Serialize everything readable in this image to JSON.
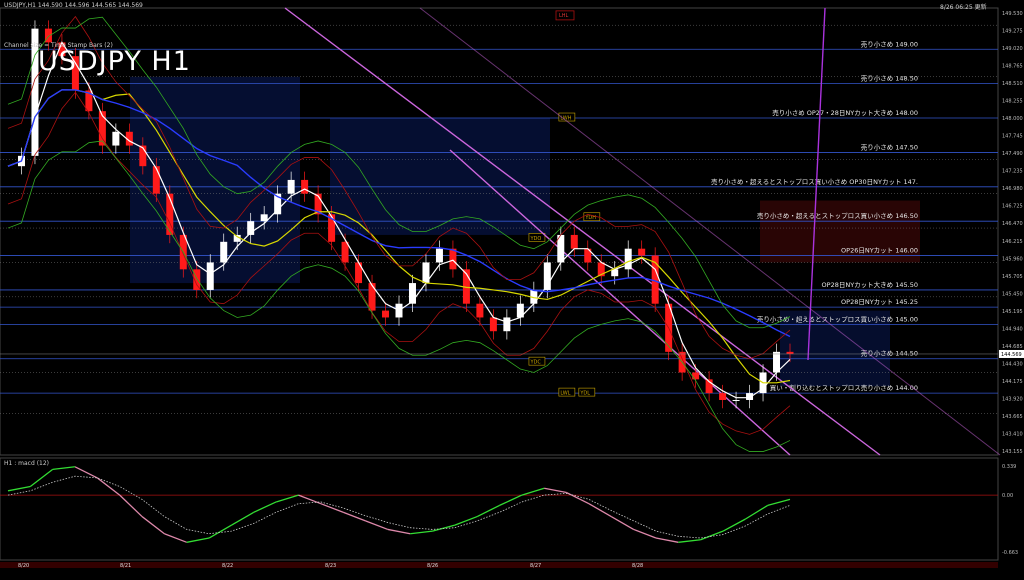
{
  "header": {
    "symbol_line": "USDJPY,H1  144.590 144.596 144.565 144.569",
    "timestamp": "8/26 06:25 更新",
    "channel_label": "Channel size = Time Stamp Bars (2)",
    "big_title": "USDJPY H1",
    "lhl_tag": "LHL"
  },
  "colors": {
    "background": "#000000",
    "up_candle": "#ffffff",
    "down_candle": "#ff1a1a",
    "sma_fast": "#ffffff",
    "sma_mid": "#d8d800",
    "sma_slow": "#2a3cff",
    "envelope": "#33aa22",
    "bollinger": "#aa1111",
    "channel": "#cc66dd",
    "level_line": "#3355cc",
    "label_text": "#e8e8e8",
    "macd_main": "#33dd33",
    "macd_main_neg": "#dd88aa",
    "macd_signal": "#cccccc"
  },
  "price_axis": {
    "labels": [
      "149.530",
      "149.275",
      "149.020",
      "148.765",
      "148.510",
      "148.255",
      "148.000",
      "147.745",
      "147.490",
      "147.235",
      "146.980",
      "146.725",
      "146.470",
      "146.215",
      "145.960",
      "145.705",
      "145.450",
      "145.195",
      "144.940",
      "144.685",
      "144.430",
      "144.175",
      "143.920",
      "143.665",
      "143.410",
      "143.155"
    ],
    "current_price": "144.569"
  },
  "levels": [
    {
      "price": 149.0,
      "label": "売り小さめ 149.00"
    },
    {
      "price": 148.5,
      "label": "売り小さめ 148.50"
    },
    {
      "price": 148.0,
      "label": "売り小さめ OP27・28日NYカット大きめ 148.00"
    },
    {
      "price": 147.5,
      "label": "売り小さめ 147.50"
    },
    {
      "price": 147.0,
      "label": "売り小さめ・超えるとストップロス買い小さめ OP30日NYカット 147."
    },
    {
      "price": 146.5,
      "label": "売り小さめ・超えるとストップロス買い小さめ 146.50"
    },
    {
      "price": 146.0,
      "label": "OP26日NYカット 146.00"
    },
    {
      "price": 145.5,
      "label": "OP28日NYカット大きめ 145.50"
    },
    {
      "price": 145.25,
      "label": "OP28日NYカット 145.25"
    },
    {
      "price": 145.0,
      "label": "売り小さめ・超えるとストップロス買い小さめ 145.00"
    },
    {
      "price": 144.5,
      "label": "売り小さめ 144.50"
    },
    {
      "price": 144.0,
      "label": "買い・割り込むとストップロス売り小さめ 144.00"
    }
  ],
  "tags": [
    {
      "text": "LWH",
      "price": 148.0,
      "x": 0.56
    },
    {
      "text": "YDH",
      "price": 146.55,
      "x": 0.585
    },
    {
      "text": "YDO",
      "price": 146.25,
      "x": 0.53
    },
    {
      "text": "YDC",
      "price": 144.45,
      "x": 0.53
    },
    {
      "text": "LWL",
      "price": 144.0,
      "x": 0.56
    },
    {
      "text": "YDL",
      "price": 144.0,
      "x": 0.58
    }
  ],
  "macd": {
    "label": "H1 : macd (12)",
    "axis_labels": [
      "0.339",
      "0.00",
      "-0.663"
    ]
  },
  "time_axis": {
    "labels": [
      "8/20",
      "8/21",
      "8/22",
      "8/23",
      "8/26",
      "8/27",
      "8/28"
    ]
  },
  "chart_data": {
    "type": "candlestick",
    "symbol": "USDJPY",
    "timeframe": "H1",
    "price_axis_range": [
      143.1,
      149.6
    ],
    "macd_range": [
      -0.663,
      0.339
    ],
    "x_categories": [
      "8/20",
      "8/21",
      "8/22",
      "8/23",
      "8/26",
      "8/27",
      "8/28"
    ],
    "close_path": [
      147.3,
      147.45,
      149.3,
      149.1,
      148.9,
      148.4,
      148.1,
      147.6,
      147.8,
      147.6,
      147.3,
      146.9,
      146.3,
      145.8,
      145.5,
      145.9,
      146.2,
      146.3,
      146.5,
      146.6,
      146.9,
      147.1,
      146.9,
      146.6,
      146.2,
      145.9,
      145.6,
      145.2,
      145.1,
      145.3,
      145.6,
      145.9,
      146.1,
      145.8,
      145.3,
      145.1,
      144.9,
      145.1,
      145.3,
      145.5,
      145.9,
      146.3,
      146.1,
      145.9,
      145.7,
      145.8,
      146.1,
      146.0,
      145.3,
      144.6,
      144.3,
      144.2,
      144.0,
      143.9,
      143.9,
      144.0,
      144.3,
      144.6,
      144.57
    ],
    "macd_main": [
      0.05,
      0.1,
      0.3,
      0.33,
      0.2,
      0.0,
      -0.25,
      -0.45,
      -0.55,
      -0.5,
      -0.35,
      -0.2,
      -0.08,
      0.0,
      -0.1,
      -0.2,
      -0.3,
      -0.4,
      -0.45,
      -0.42,
      -0.35,
      -0.25,
      -0.12,
      0.0,
      0.08,
      0.03,
      -0.1,
      -0.25,
      -0.4,
      -0.5,
      -0.55,
      -0.52,
      -0.42,
      -0.28,
      -0.12,
      -0.05
    ],
    "macd_signal": [
      0.0,
      0.05,
      0.15,
      0.22,
      0.2,
      0.1,
      -0.05,
      -0.25,
      -0.4,
      -0.45,
      -0.42,
      -0.33,
      -0.2,
      -0.1,
      -0.08,
      -0.15,
      -0.24,
      -0.32,
      -0.38,
      -0.4,
      -0.38,
      -0.3,
      -0.2,
      -0.08,
      0.0,
      0.02,
      -0.05,
      -0.18,
      -0.3,
      -0.42,
      -0.48,
      -0.5,
      -0.46,
      -0.36,
      -0.22,
      -0.12
    ],
    "current_price": 144.569
  }
}
